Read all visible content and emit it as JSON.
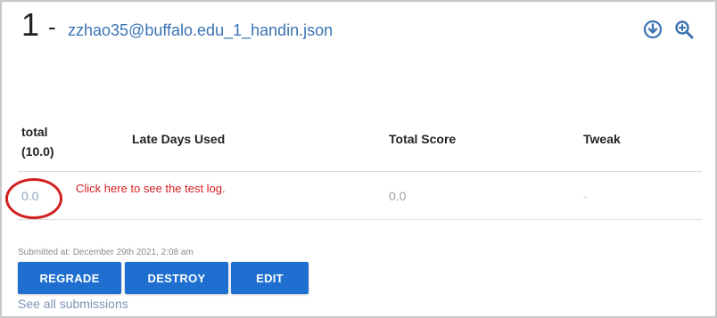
{
  "header": {
    "number": "1",
    "dash": "-",
    "filename": "zzhao35@buffalo.edu_1_handin.json",
    "icons": {
      "download": "download-circle-icon",
      "zoom": "zoom-in-icon"
    },
    "accent_color": "#3a73b4"
  },
  "table": {
    "columns": {
      "total_line1": "total",
      "total_line2": "(10.0)",
      "late_days": "Late Days Used",
      "total_score": "Total Score",
      "tweak": "Tweak"
    },
    "row": {
      "total": "0.0",
      "late_days": "",
      "total_score": "0.0",
      "tweak": "-"
    }
  },
  "annotation": {
    "text": "Click here to see the test log.",
    "color": "#d21f1f"
  },
  "footer": {
    "submitted_at": "Submitted at: December 29th 2021, 2:08 am",
    "buttons": {
      "regrade": "REGRADE",
      "destroy": "DESTROY",
      "edit": "EDIT"
    },
    "button_color": "#1e6fd0",
    "see_all": "See all submissions"
  }
}
